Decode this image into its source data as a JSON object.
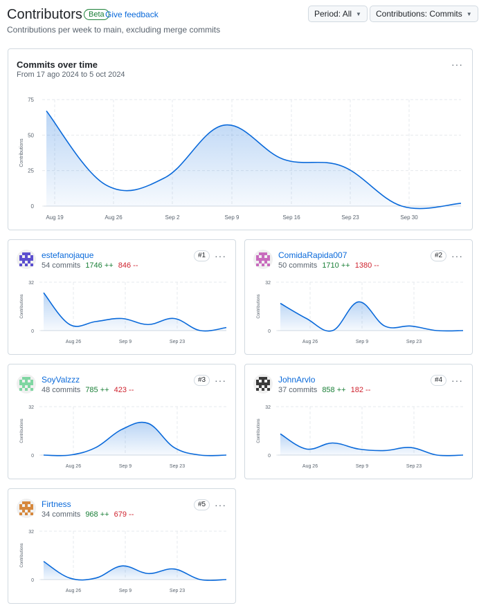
{
  "header": {
    "title": "Contributors",
    "beta_badge": "Beta",
    "feedback_link": "Give feedback",
    "subtitle": "Contributions per week to main, excluding merge commits",
    "period_button": "Period: All",
    "contrib_button": "Contributions: Commits"
  },
  "main_chart": {
    "title": "Commits over time",
    "subtitle": "From 17 ago 2024 to 5 oct 2024",
    "menu": "···",
    "chart_data": {
      "type": "area",
      "ylabel": "Contributions",
      "ylim": [
        0,
        75
      ],
      "yticks": [
        "75",
        "50",
        "25",
        "0"
      ],
      "xticks": [
        "Aug 19",
        "Aug 26",
        "Sep 2",
        "Sep 9",
        "Sep 16",
        "Sep 23",
        "Sep 30"
      ],
      "x": [
        "Aug 18",
        "Aug 25",
        "Sep 1",
        "Sep 8",
        "Sep 15",
        "Sep 22",
        "Sep 29",
        "Oct 6"
      ],
      "values": [
        67,
        15,
        20,
        57,
        33,
        28,
        0,
        2
      ],
      "color": "#0969da"
    }
  },
  "contributors": [
    {
      "rank": "#1",
      "name": "estefanojaque",
      "commits": "54 commits",
      "additions": "1746 ++",
      "deletions": "846 --",
      "avatar_color": "#5b4fcf",
      "chart_data": {
        "type": "area",
        "ylabel": "Contributions",
        "ylim": [
          0,
          32
        ],
        "yticks": [
          "32",
          "0"
        ],
        "xticks": [
          "Aug 26",
          "Sep 9",
          "Sep 23"
        ],
        "x": [
          "Aug 18",
          "Aug 25",
          "Sep 1",
          "Sep 8",
          "Sep 15",
          "Sep 22",
          "Sep 29",
          "Oct 6"
        ],
        "values": [
          25,
          4,
          6,
          8,
          4,
          8,
          0,
          2
        ]
      }
    },
    {
      "rank": "#2",
      "name": "ComidaRapida007",
      "commits": "50 commits",
      "additions": "1710 ++",
      "deletions": "1380 --",
      "avatar_color": "#c86bbd",
      "chart_data": {
        "type": "area",
        "ylabel": "Contributions",
        "ylim": [
          0,
          32
        ],
        "yticks": [
          "32",
          "0"
        ],
        "xticks": [
          "Aug 26",
          "Sep 9",
          "Sep 23"
        ],
        "x": [
          "Aug 18",
          "Aug 25",
          "Sep 1",
          "Sep 8",
          "Sep 15",
          "Sep 22",
          "Sep 29",
          "Oct 6"
        ],
        "values": [
          18,
          8,
          0,
          19,
          3,
          3,
          0,
          0
        ]
      }
    },
    {
      "rank": "#3",
      "name": "SoyValzzz",
      "commits": "48 commits",
      "additions": "785 ++",
      "deletions": "423 --",
      "avatar_color": "#7fd6a2",
      "chart_data": {
        "type": "area",
        "ylabel": "Contributions",
        "ylim": [
          0,
          32
        ],
        "yticks": [
          "32",
          "0"
        ],
        "xticks": [
          "Aug 26",
          "Sep 9",
          "Sep 23"
        ],
        "x": [
          "Aug 18",
          "Aug 25",
          "Sep 1",
          "Sep 8",
          "Sep 15",
          "Sep 22",
          "Sep 29",
          "Oct 6"
        ],
        "values": [
          0,
          0,
          5,
          17,
          21,
          5,
          0,
          0
        ]
      }
    },
    {
      "rank": "#4",
      "name": "JohnArvlo",
      "commits": "37 commits",
      "additions": "858 ++",
      "deletions": "182 --",
      "avatar_color": "#3a3a3a",
      "chart_data": {
        "type": "area",
        "ylabel": "Contributions",
        "ylim": [
          0,
          32
        ],
        "yticks": [
          "32",
          "0"
        ],
        "xticks": [
          "Aug 26",
          "Sep 9",
          "Sep 23"
        ],
        "x": [
          "Aug 18",
          "Aug 25",
          "Sep 1",
          "Sep 8",
          "Sep 15",
          "Sep 22",
          "Sep 29",
          "Oct 6"
        ],
        "values": [
          14,
          4,
          8,
          4,
          3,
          5,
          0,
          0
        ]
      }
    },
    {
      "rank": "#5",
      "name": "Firtness",
      "commits": "34 commits",
      "additions": "968 ++",
      "deletions": "679 --",
      "avatar_color": "#d6883d",
      "chart_data": {
        "type": "area",
        "ylabel": "Contributions",
        "ylim": [
          0,
          32
        ],
        "yticks": [
          "32",
          "0"
        ],
        "xticks": [
          "Aug 26",
          "Sep 9",
          "Sep 23"
        ],
        "x": [
          "Aug 18",
          "Aug 25",
          "Sep 1",
          "Sep 8",
          "Sep 15",
          "Sep 22",
          "Sep 29",
          "Oct 6"
        ],
        "values": [
          12,
          1,
          1,
          9,
          4,
          7,
          0,
          0
        ]
      }
    }
  ]
}
